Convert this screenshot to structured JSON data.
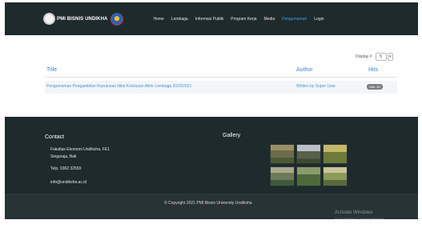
{
  "header": {
    "brand_text": "PMI BISNIS UNDIKHA",
    "nav": [
      {
        "label": "Home"
      },
      {
        "label": "Lembaga"
      },
      {
        "label": "Informasi Publik"
      },
      {
        "label": "Program Kerja"
      },
      {
        "label": "Media"
      },
      {
        "label": "Pengumuman"
      },
      {
        "label": "Login"
      }
    ]
  },
  "content": {
    "display_label": "Display #",
    "display_value": "5",
    "table": {
      "headers": {
        "title": "Title",
        "author": "Author",
        "hits": "Hits"
      },
      "rows": [
        {
          "title": "Pengumuman Pengambilan Keputusan Nilai Kelulusan Akhir Lembaga 2020/2021",
          "author": "Written by Super User",
          "hits": "Hits: 39"
        }
      ]
    }
  },
  "footer": {
    "contact_title": "Contact",
    "gallery_title": "Gallery",
    "contact_lines": [
      "Fakultas Ekonomi Undiksha, FE1",
      "Singaraja, Bali",
      "Telp. 0362 32559",
      "info@undiksha.ac.id"
    ],
    "copyright": "© Copyright 2021 PMI Bisnis University Undiksha",
    "watermark_title": "Activate Windows",
    "watermark_sub": "Go to Settings to activate Windows."
  },
  "colors": {
    "header_bg": "#1e2a2c",
    "link": "#4a90d9",
    "accent": "#4aa3e0"
  }
}
